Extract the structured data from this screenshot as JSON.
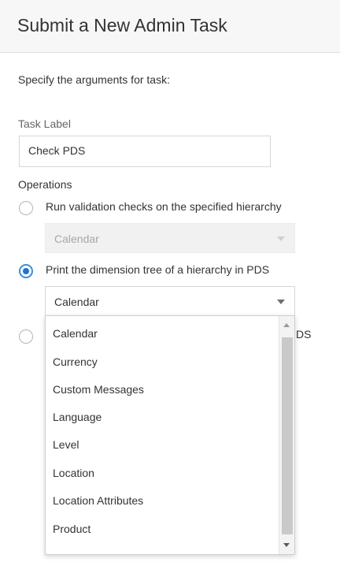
{
  "header": {
    "title": "Submit a New Admin Task"
  },
  "form": {
    "instructions": "Specify the arguments for task:",
    "task_label": {
      "label": "Task Label",
      "value": "Check PDS"
    },
    "operations_label": "Operations",
    "operations": [
      {
        "label": "Run validation checks on the specified hierarchy",
        "selected": false,
        "select_value": "Calendar",
        "select_disabled": true
      },
      {
        "label": "Print the dimension tree of a hierarchy in PDS",
        "selected": true,
        "select_value": "Calendar",
        "select_disabled": false
      },
      {
        "label": "DS",
        "selected": false
      }
    ]
  },
  "dropdown": {
    "options": [
      "Calendar",
      "Currency",
      "Custom Messages",
      "Language",
      "Level",
      "Location",
      "Location Attributes",
      "Product"
    ]
  },
  "colors": {
    "accent": "#1b76d2",
    "header_bg": "#f7f7f7"
  }
}
